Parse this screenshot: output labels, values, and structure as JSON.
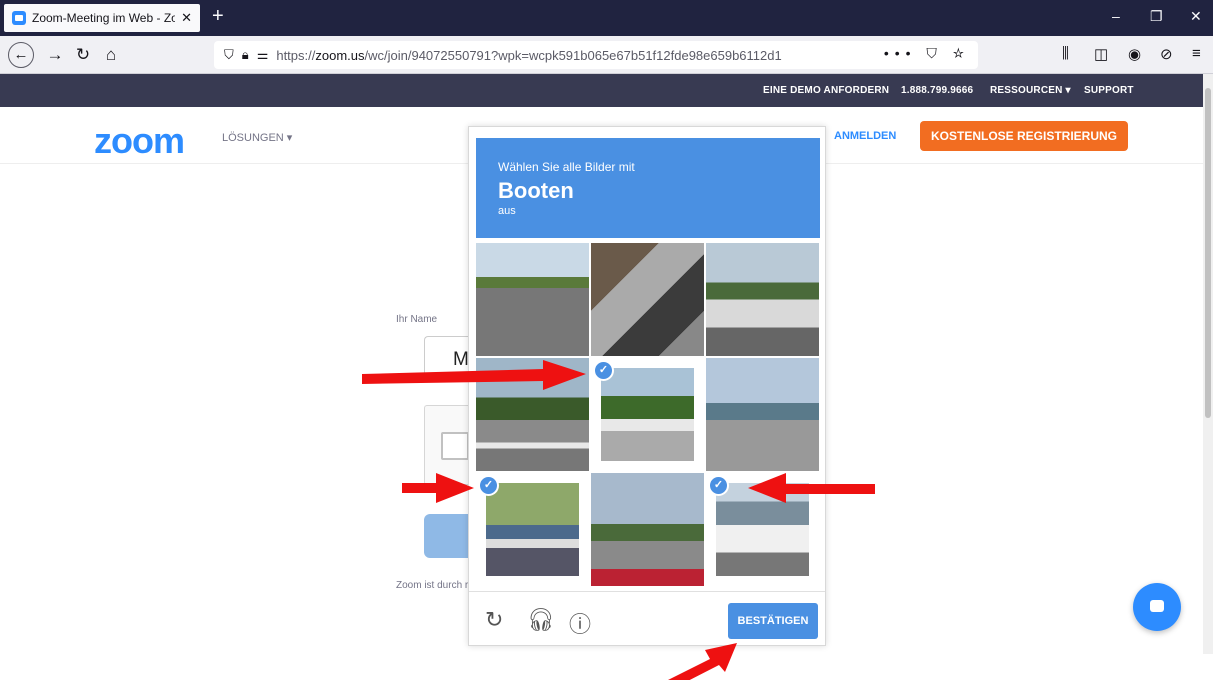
{
  "browser": {
    "tab_title": "Zoom-Meeting im Web - Zoom",
    "tab_close": "✕",
    "new_tab": "+",
    "url_domain": "zoom.us",
    "url_prefix": "https://",
    "url_path": "/wc/join/94072550791?wpk=wcpk591b065e67b51f12fde98e659b6112d1",
    "url_actions": "••• ⛉ ☆"
  },
  "zoom": {
    "topbar": {
      "demo": "EINE DEMO ANFORDERN",
      "phone": "1.888.799.9666",
      "resources": "RESSOURCEN ▾",
      "support": "SUPPORT"
    },
    "logo": "zoom",
    "solutions": "LÖSUNGEN ▾",
    "signin": "ANMELDEN",
    "signup": "KOSTENLOSE REGISTRIERUNG",
    "name_label": "Ihr Name",
    "name_value": "Mic",
    "terms": "Zoom ist durch r"
  },
  "captcha": {
    "prompt": "Wählen Sie alle Bilder mit",
    "target": "Booten",
    "suffix": "aus",
    "submit": "BESTÄTIGEN",
    "tiles": [
      {
        "name": "tile-road",
        "selected": false
      },
      {
        "name": "tile-motorcycle",
        "selected": false
      },
      {
        "name": "tile-car",
        "selected": false
      },
      {
        "name": "tile-crosswalk",
        "selected": false
      },
      {
        "name": "tile-boat-trailer",
        "selected": true
      },
      {
        "name": "tile-intersection",
        "selected": false
      },
      {
        "name": "tile-boats-lot",
        "selected": true
      },
      {
        "name": "tile-traffic-light",
        "selected": false
      },
      {
        "name": "tile-boat-dock",
        "selected": true
      }
    ]
  },
  "colors": {
    "zoom_blue": "#2d8cff",
    "signup_orange": "#f26d21",
    "captcha_blue": "#4a90e2",
    "arrow_red": "#ee1111"
  }
}
